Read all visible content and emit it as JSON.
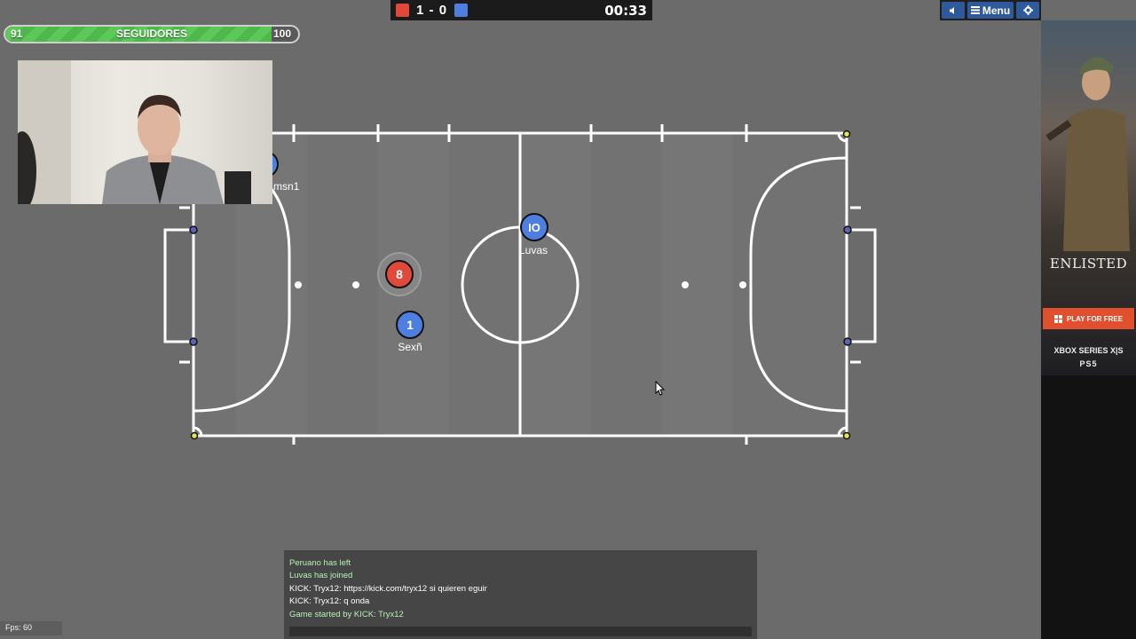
{
  "followers": {
    "title": "SEGUIDORES",
    "min": "91",
    "max": "100",
    "progress_fraction": 0.9
  },
  "scoreboard": {
    "red_score": "1",
    "separator": "-",
    "blue_score": "0",
    "timer": "00:33",
    "red_color": "#e0493a",
    "blue_color": "#4d7ee0"
  },
  "controls": {
    "menu_label": "Menu",
    "sound_icon": "speaker-icon",
    "menu_icon": "hamburger-icon",
    "settings_icon": "gear-icon"
  },
  "players": [
    {
      "number": "8",
      "name": "",
      "team": "red"
    },
    {
      "number": "1",
      "name": "Sexñ",
      "team": "blue"
    },
    {
      "number": "IO",
      "name": "Luvas",
      "team": "blue"
    },
    {
      "number": "",
      "name": "msn1",
      "team": "blue"
    }
  ],
  "chat": {
    "messages": [
      {
        "text": "Peruano has left",
        "color": "#b8f0b8"
      },
      {
        "text": "Luvas has joined",
        "color": "#b8f0b8"
      },
      {
        "text": "KICK: Tryx12: https://kick.com/tryx12 si quieren eguir",
        "color": "#ffffff"
      },
      {
        "text": "KICK: Tryx12: q onda",
        "color": "#ffffff"
      },
      {
        "text": "Game started by KICK: Tryx12",
        "color": "#b8f0b8"
      }
    ]
  },
  "fps": "Fps: 60",
  "ad": {
    "logo": "ENLISTED",
    "cta": "PLAY FOR FREE",
    "platform1": "XBOX SERIES X|S",
    "platform2": "PS5"
  }
}
